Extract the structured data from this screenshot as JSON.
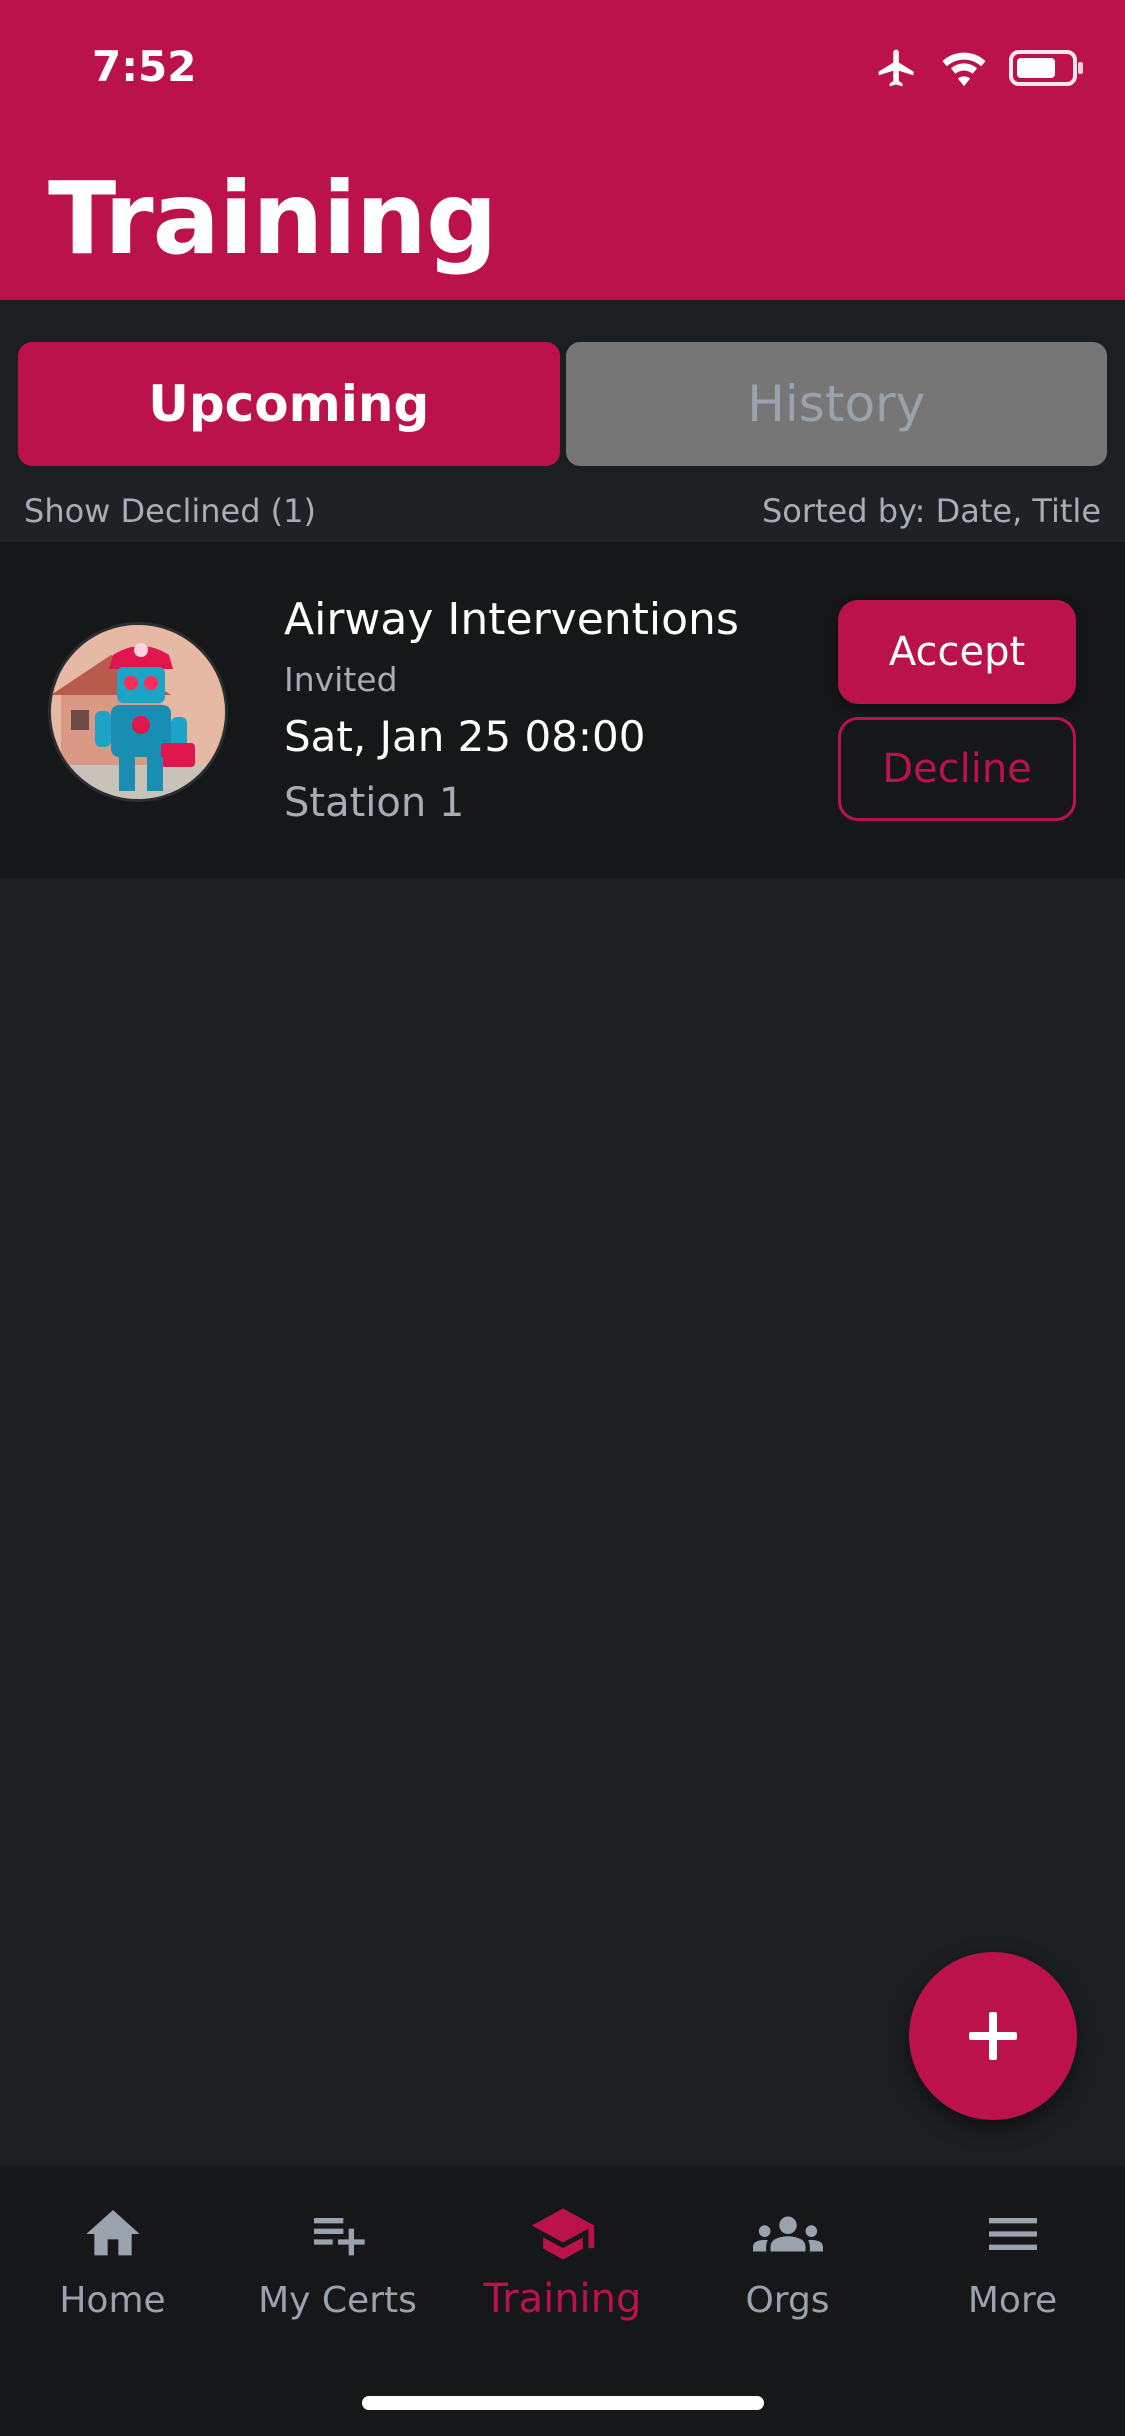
{
  "status_bar": {
    "time": "7:52"
  },
  "header": {
    "title": "Training"
  },
  "tabs": [
    {
      "label": "Upcoming",
      "active": true
    },
    {
      "label": "History",
      "active": false
    }
  ],
  "filter": {
    "show_declined": "Show Declined (1)",
    "sorted_by": "Sorted by: Date, Title"
  },
  "training_card": {
    "title": "Airway Interventions",
    "status": "Invited",
    "date": "Sat, Jan 25 08:00",
    "location": "Station 1",
    "accept_label": "Accept",
    "decline_label": "Decline"
  },
  "bottom_nav": [
    {
      "label": "Home",
      "icon": "home-icon"
    },
    {
      "label": "My Certs",
      "icon": "playlist-add-icon"
    },
    {
      "label": "Training",
      "icon": "graduation-cap-icon",
      "active": true
    },
    {
      "label": "Orgs",
      "icon": "groups-icon"
    },
    {
      "label": "More",
      "icon": "menu-icon"
    }
  ],
  "colors": {
    "accent": "#bc124b",
    "background": "#1c1f22",
    "card": "#151719",
    "muted_text": "#a6adb5"
  }
}
